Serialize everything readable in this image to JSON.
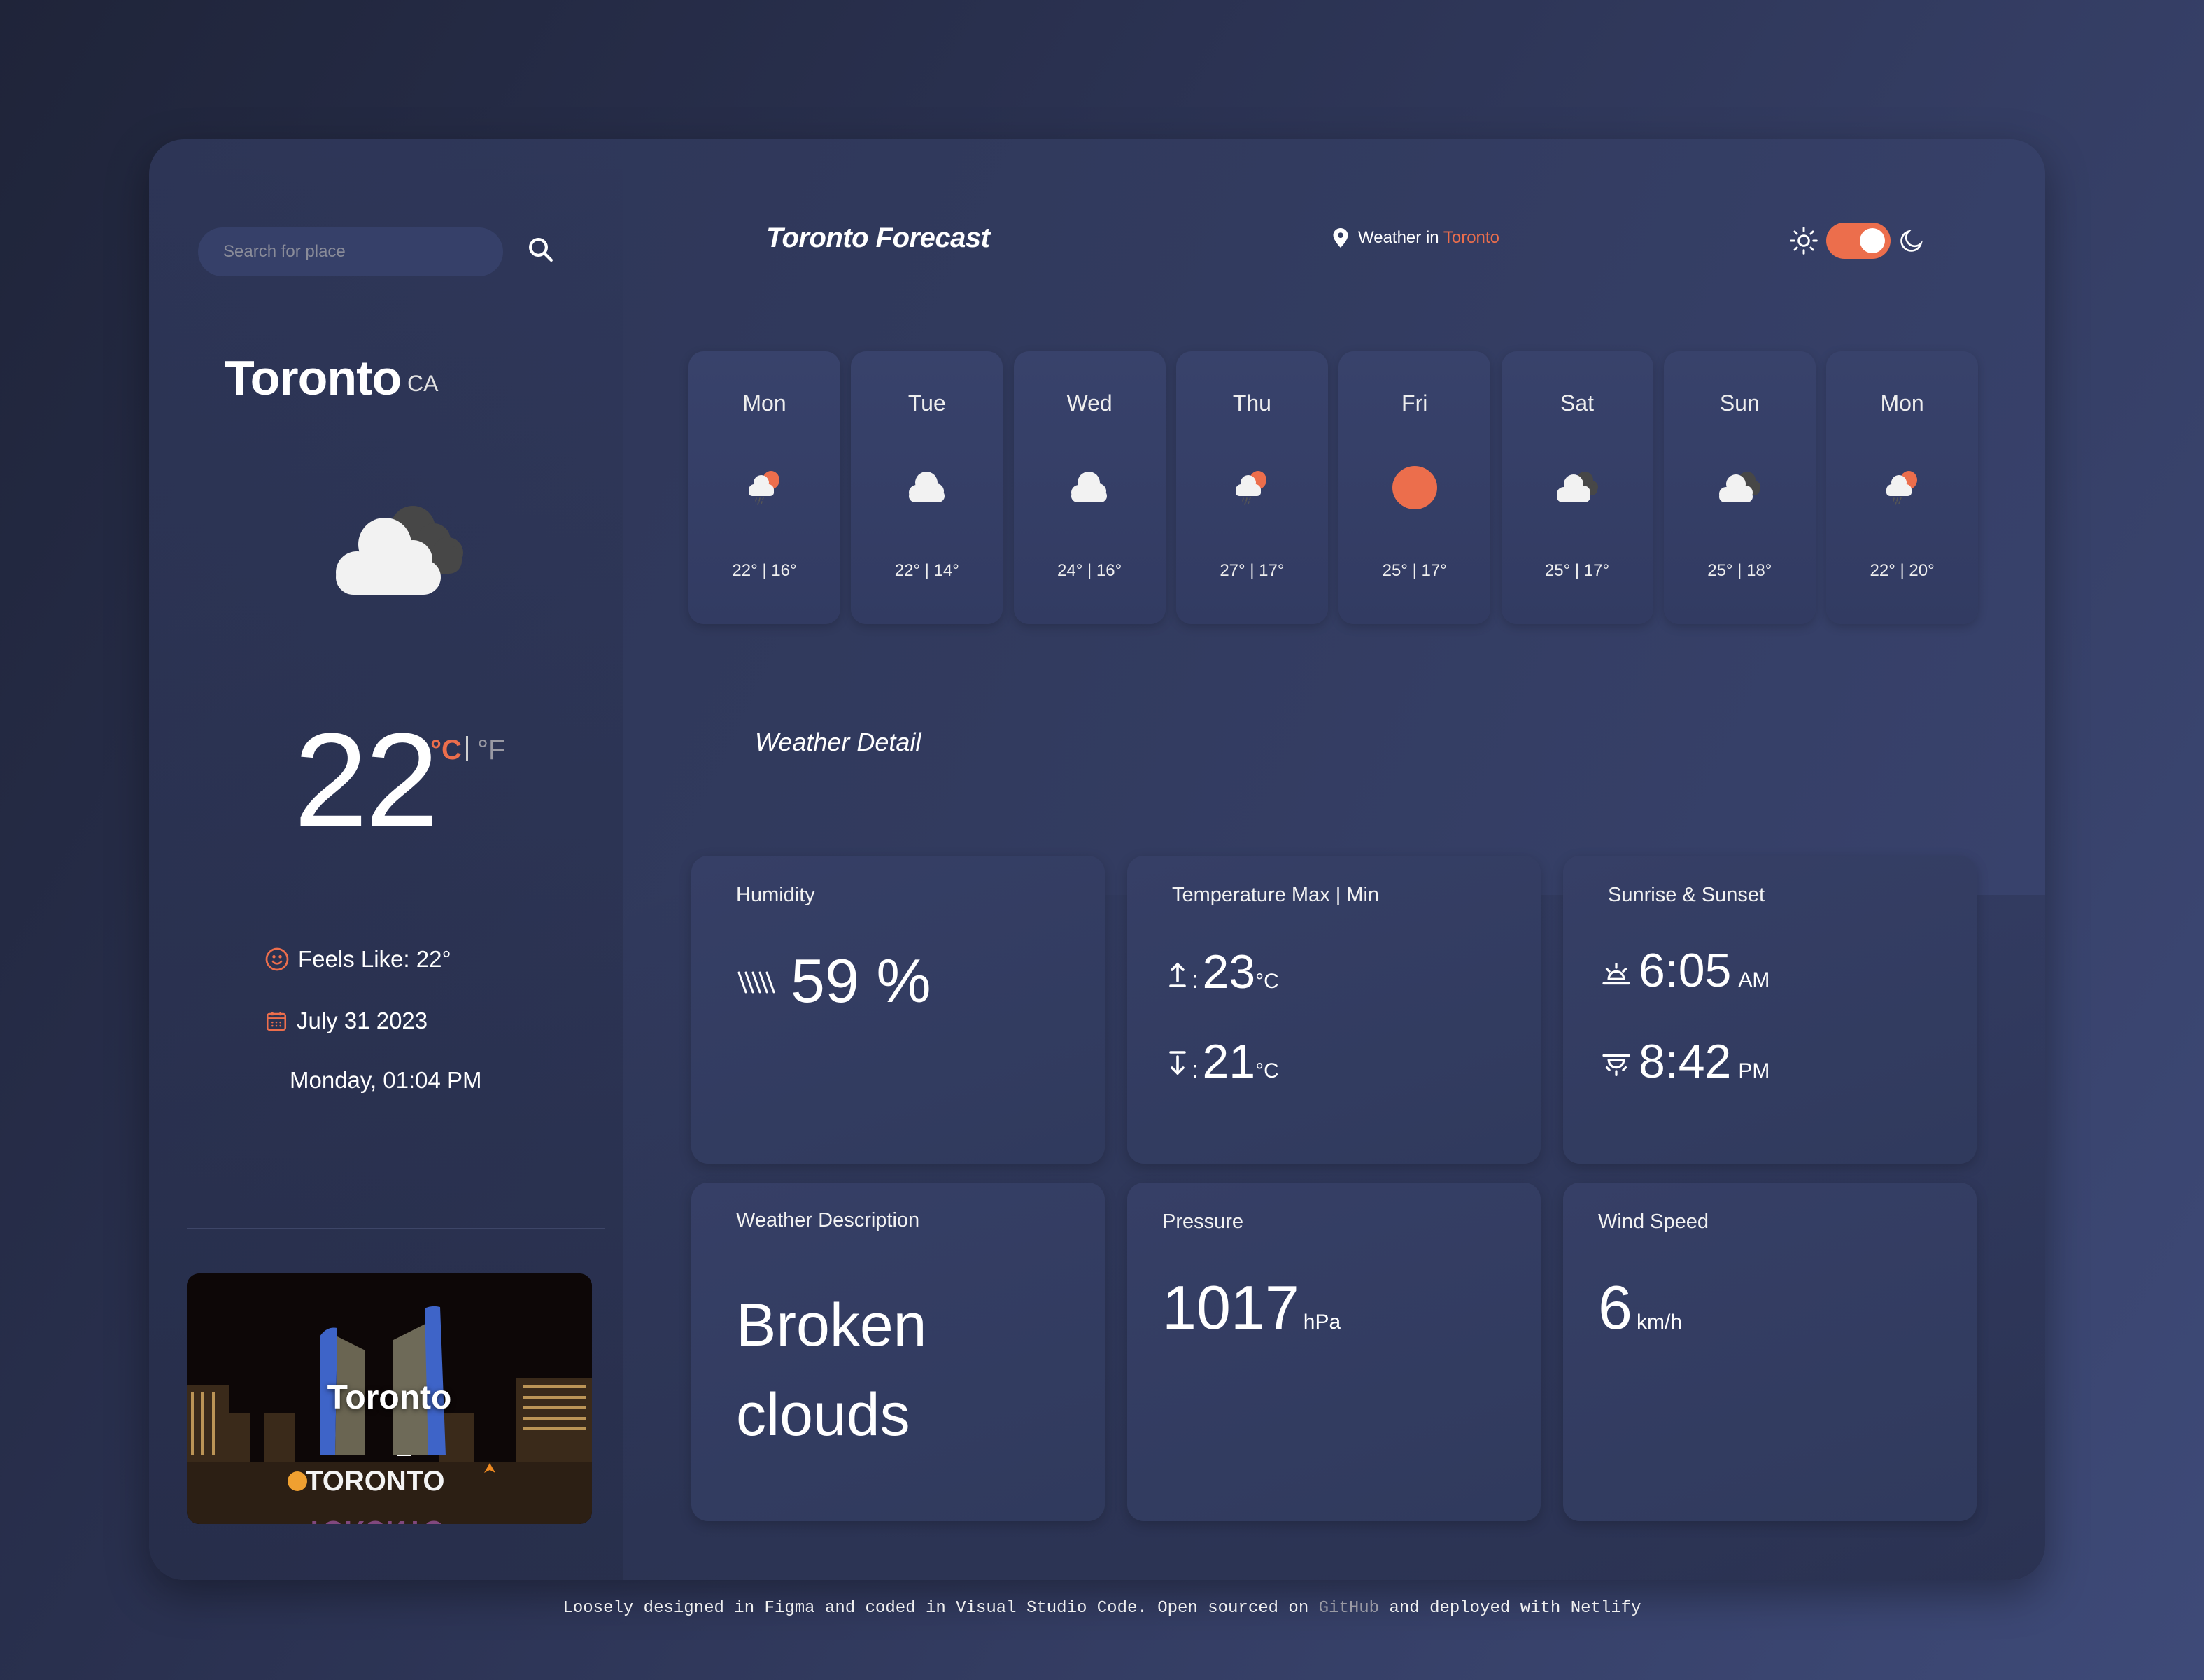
{
  "search": {
    "placeholder": "Search for place"
  },
  "header": {
    "title": "Toronto Forecast",
    "location_prefix": "Weather in",
    "location_city": "Toronto",
    "theme": "dark"
  },
  "current": {
    "city": "Toronto",
    "country": "CA",
    "icon": "broken-clouds",
    "temperature": "22",
    "unit_c": "°C",
    "unit_f": "°F",
    "active_unit": "C",
    "feels_like": "Feels Like: 22°",
    "date": "July 31 2023",
    "day_time": "Monday, 01:04 PM",
    "image_caption": "Toronto"
  },
  "forecast": [
    {
      "day": "Mon",
      "icon": "sun-rain",
      "temps": "22° | 16°"
    },
    {
      "day": "Tue",
      "icon": "cloud",
      "temps": "22° | 14°"
    },
    {
      "day": "Wed",
      "icon": "cloud",
      "temps": "24° | 16°"
    },
    {
      "day": "Thu",
      "icon": "sun-rain",
      "temps": "27° | 17°"
    },
    {
      "day": "Fri",
      "icon": "sun",
      "temps": "25° | 17°"
    },
    {
      "day": "Sat",
      "icon": "broken-clouds",
      "temps": "25° | 17°"
    },
    {
      "day": "Sun",
      "icon": "broken-clouds",
      "temps": "25° | 18°"
    },
    {
      "day": "Mon",
      "icon": "sun-rain",
      "temps": "22° | 20°"
    }
  ],
  "details": {
    "title": "Weather Detail",
    "humidity": {
      "label": "Humidity",
      "value": "59 %"
    },
    "temp_max_min": {
      "label": "Temperature Max | Min",
      "max": "23",
      "min": "21",
      "unit": "°C",
      "sep": ":"
    },
    "sun": {
      "label": "Sunrise & Sunset",
      "sunrise": "6:05",
      "sunrise_period": "AM",
      "sunset": "8:42",
      "sunset_period": "PM"
    },
    "description": {
      "label": "Weather Description",
      "line1": "Broken",
      "line2": "clouds"
    },
    "pressure": {
      "label": "Pressure",
      "value": "1017",
      "unit": "hPa"
    },
    "wind": {
      "label": "Wind Speed",
      "value": "6",
      "unit": "km/h"
    }
  },
  "footer": {
    "before": "Loosely designed in Figma and coded in Visual Studio Code. Open sourced on ",
    "link": "GitHub",
    "after": " and deployed with Netlify"
  },
  "colors": {
    "accent": "#ec6e4c",
    "text": "#ffffff",
    "muted": "#9a9aa4"
  }
}
